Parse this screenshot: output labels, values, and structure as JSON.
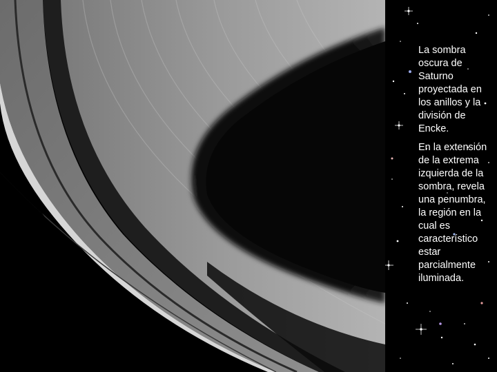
{
  "slide": {
    "background_color": "#000000",
    "text_color": "#ffffff",
    "image_subject": "saturn-rings-with-planet-shadow",
    "captions": [
      "La sombra oscura de Saturno proyectada en los anillos y la división de Encke.",
      "En la extensión de la extrema izquierda de la sombra, revela una penumbra, la región en la cual es característico estar parcialmente iluminada."
    ]
  }
}
